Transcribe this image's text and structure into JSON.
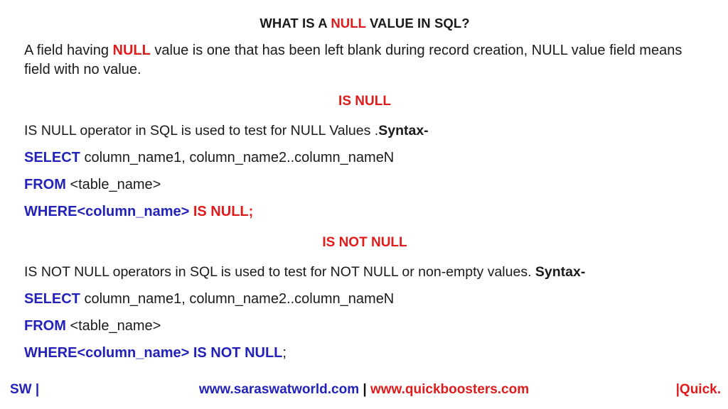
{
  "slide": {
    "background_color": "#ffffff",
    "accent_red": "#e01b1b",
    "accent_blue": "#2222bb",
    "text_color": "#1a1a1a"
  },
  "title": {
    "before": "WHAT IS A ",
    "highlight": "NULL",
    "after": " VALUE IN SQL?"
  },
  "intro": {
    "part1": "A field having ",
    "highlight": "NULL",
    "part2": " value is one that has been left blank during record creation, NULL value field means field with no value."
  },
  "is_null": {
    "heading": "IS NULL",
    "description": "IS NULL operator in SQL is used to test for NULL Values .",
    "syntax_label": "Syntax-",
    "code": {
      "select_kw": "SELECT",
      "select_args": " column_name1, column_name2..column_nameN",
      "from_kw": "FROM",
      "from_args": " <table_name>",
      "where_kw": "WHERE",
      "where_col": "<column_name>",
      "where_cond": " IS NULL;"
    }
  },
  "is_not_null": {
    "heading": "IS NOT NULL",
    "description": " IS NOT NULL operators in SQL is used to test for NOT NULL or non-empty values. ",
    "syntax_label": "Syntax-",
    "code": {
      "select_kw": "SELECT",
      "select_args": " column_name1, column_name2..column_nameN",
      "from_kw": "FROM",
      "from_args": " <table_name>",
      "where_kw": "WHERE",
      "where_col": "<column_name>",
      "where_cond": " IS NOT NULL",
      "where_semicolon": ";"
    }
  },
  "footer": {
    "left": "SW |",
    "url_primary": "www.saraswatworld.com",
    "separator": " | ",
    "url_secondary": "www.quickboosters.com",
    "right": "|Quick."
  }
}
